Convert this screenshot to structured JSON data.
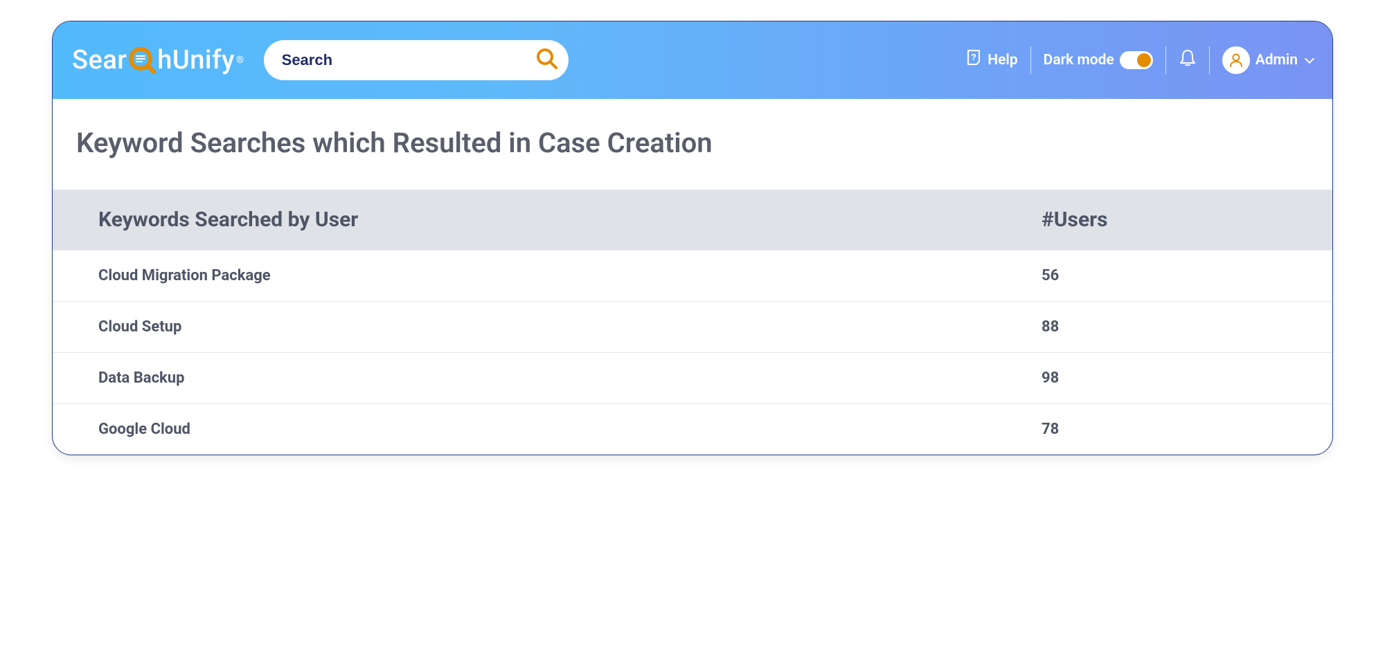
{
  "header": {
    "logo_text_a": "Sear",
    "logo_text_b": "hUnify",
    "logo_reg": "®",
    "search_placeholder": "Search",
    "help_label": "Help",
    "darkmode_label": "Dark mode",
    "user_role": "Admin"
  },
  "page": {
    "title": "Keyword Searches which Resulted in Case Creation",
    "col_keywords": "Keywords Searched by User",
    "col_users": "#Users",
    "rows": [
      {
        "keyword": "Cloud Migration Package",
        "users": "56"
      },
      {
        "keyword": "Cloud Setup",
        "users": "88"
      },
      {
        "keyword": "Data Backup",
        "users": "98"
      },
      {
        "keyword": "Google Cloud",
        "users": "78"
      }
    ]
  },
  "chart_data": {
    "type": "table",
    "columns": [
      "Keywords Searched by User",
      "#Users"
    ],
    "rows": [
      [
        "Cloud Migration Package",
        56
      ],
      [
        "Cloud Setup",
        88
      ],
      [
        "Data Backup",
        98
      ],
      [
        "Google Cloud",
        78
      ]
    ]
  }
}
